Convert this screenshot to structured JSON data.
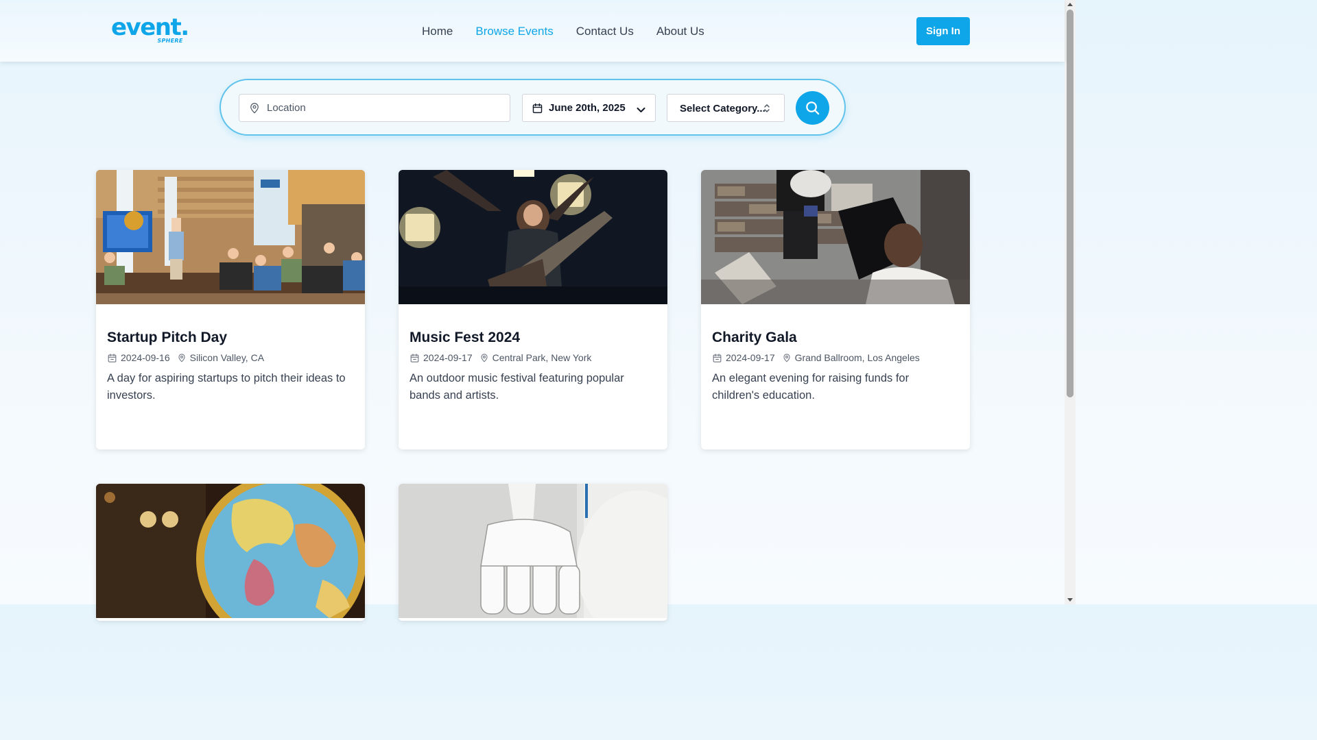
{
  "brand": {
    "logo_main": "event.",
    "logo_sub": "SPHERE"
  },
  "nav": {
    "items": [
      {
        "label": "Home",
        "active": false
      },
      {
        "label": "Browse Events",
        "active": true
      },
      {
        "label": "Contact Us",
        "active": false
      },
      {
        "label": "About Us",
        "active": false
      }
    ],
    "signin_label": "Sign In"
  },
  "search": {
    "location_placeholder": "Location",
    "location_value": "",
    "location_icon": "map-pin-icon",
    "date_value": "June 20th, 2025",
    "category_value": "Select Category...",
    "search_icon": "search-icon"
  },
  "events": [
    {
      "title": "Startup Pitch Day",
      "date": "2024-09-16",
      "location": "Silicon Valley, CA",
      "description": "A day for aspiring startups to pitch their ideas to investors.",
      "image": "presentation-office-photo"
    },
    {
      "title": "Music Fest 2024",
      "date": "2024-09-17",
      "location": "Central Park, New York",
      "description": "An outdoor music festival featuring popular bands and artists.",
      "image": "rock-guitarist-concert-photo"
    },
    {
      "title": "Charity Gala",
      "date": "2024-09-17",
      "location": "Grand Ballroom, Los Angeles",
      "description": "An elegant evening for raising funds for children's education.",
      "image": "volunteers-carrying-boxes-photo"
    },
    {
      "title": "",
      "date": "",
      "location": "",
      "description": "",
      "image": "desk-globe-photo"
    },
    {
      "title": "",
      "date": "",
      "location": "",
      "description": "",
      "image": "robot-hand-photo"
    }
  ],
  "colors": {
    "accent": "#0ea5e9",
    "background": "#eef7fd"
  }
}
